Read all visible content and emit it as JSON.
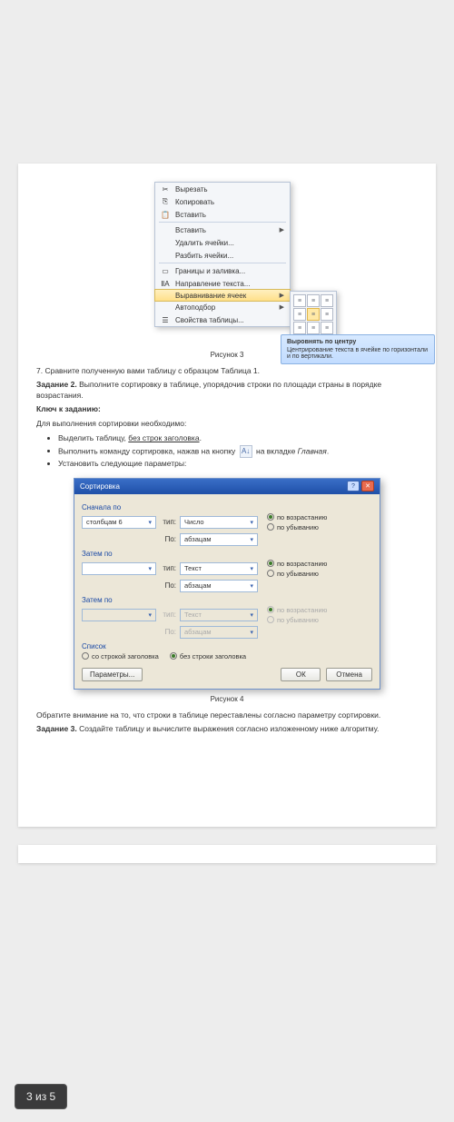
{
  "context_menu": {
    "items": [
      {
        "icon": "✂",
        "label": "Вырезать",
        "arrow": false
      },
      {
        "icon": "⎘",
        "label": "Копировать",
        "arrow": false
      },
      {
        "icon": "📋",
        "label": "Вставить",
        "arrow": false
      },
      {
        "sep": true
      },
      {
        "icon": "",
        "label": "Вставить",
        "arrow": true
      },
      {
        "icon": "",
        "label": "Удалить ячейки...",
        "arrow": false
      },
      {
        "icon": "",
        "label": "Разбить ячейки...",
        "arrow": false
      },
      {
        "sep": true
      },
      {
        "icon": "▭",
        "label": "Границы и заливка...",
        "arrow": false
      },
      {
        "icon": "ⅡA",
        "label": "Направление текста...",
        "arrow": false
      },
      {
        "icon": "",
        "label": "Выравнивание ячеек",
        "arrow": true,
        "hl": true
      },
      {
        "icon": "",
        "label": "Автоподбор",
        "arrow": true
      },
      {
        "icon": "☰",
        "label": "Свойства таблицы...",
        "arrow": false
      }
    ]
  },
  "tooltip": {
    "title": "Выровнять по центру",
    "desc": "Центрирование текста в ячейке по горизонтали и по вертикали."
  },
  "captions": {
    "fig3": "Рисунок 3",
    "fig4": "Рисунок 4"
  },
  "step7": "7. Сравните полученную вами таблицу с образцом Таблица 1.",
  "task2_label": "Задание 2.",
  "task2_text": " Выполните сортировку в таблице, упорядочив строки по площади страны в порядке возрастания.",
  "key_label": "Ключ к заданию:",
  "key_intro": "Для выполнения сортировки необходимо:",
  "bullets": {
    "b1_a": "Выделить таблицу, ",
    "b1_b": "без строк заголовка",
    "b1_c": ".",
    "b2_a": "Выполнить команду сортировка, нажав на кнопку ",
    "b2_b": " на вкладке ",
    "b2_c": "Главная",
    "b2_d": ".",
    "b3": "Установить следующие параметры:"
  },
  "sort_dialog": {
    "title": "Сортировка",
    "grp1": "Сначала по",
    "grp2": "Затем по",
    "grp3": "Затем по",
    "col1": "столбцам 6",
    "type_lbl": "тип:",
    "po_lbl": "По:",
    "type_num": "Число",
    "type_text": "Текст",
    "po_val": "абзацам",
    "asc": "по возрастанию",
    "desc": "по убыванию",
    "list_lbl": "Список",
    "with_header": "со строкой заголовка",
    "no_header": "без строки заголовка",
    "params": "Параметры...",
    "ok": "ОК",
    "cancel": "Отмена"
  },
  "note": "Обратите внимание на то, что строки в таблице переставлены согласно параметру сортировки.",
  "task3_label": "Задание 3.",
  "task3_text": " Создайте таблицу и вычислите выражения согласно изложенному ниже алгоритму.",
  "pager": "3 из 5"
}
